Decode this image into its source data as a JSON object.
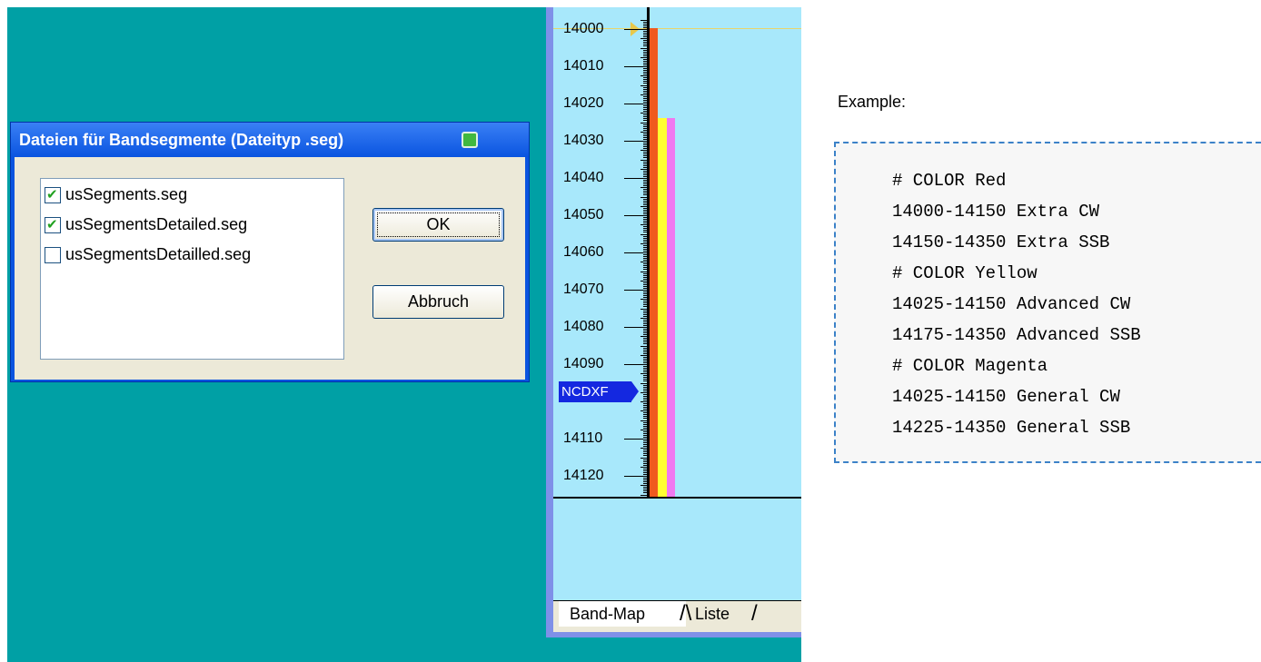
{
  "dialog": {
    "title": "Dateien für Bandsegmente (Dateityp .seg)",
    "files": [
      {
        "name": "usSegments.seg",
        "checked": true
      },
      {
        "name": "usSegmentsDetailed.seg",
        "checked": true
      },
      {
        "name": "usSegmentsDetailled.seg",
        "checked": false
      }
    ],
    "ok_label": "OK",
    "cancel_label": "Abbruch"
  },
  "bandmap": {
    "frequency_labels": [
      "14000",
      "14010",
      "14020",
      "14030",
      "14040",
      "14050",
      "14060",
      "14070",
      "14080",
      "14090",
      "14110",
      "14120"
    ],
    "spot_label": "NCDXF",
    "segment_colors": {
      "red": "#f05a1e",
      "yellow": "#ffff30",
      "magenta": "#f078f0"
    },
    "tabs": [
      {
        "label": "Band-Map",
        "active": true
      },
      {
        "label": "Liste",
        "active": false
      }
    ]
  },
  "example": {
    "heading": "Example:",
    "lines": [
      "# COLOR Red",
      "14000-14150 Extra CW",
      "14150-14350 Extra SSB",
      "# COLOR Yellow",
      "14025-14150 Advanced CW",
      "14175-14350 Advanced SSB",
      "# COLOR Magenta",
      "14025-14150 General CW",
      "14225-14350 General SSB"
    ]
  },
  "colors": {
    "desktop": "#00a0a5",
    "bandmap_background": "#a8e8fb",
    "titlebar": "#0a54e0"
  }
}
